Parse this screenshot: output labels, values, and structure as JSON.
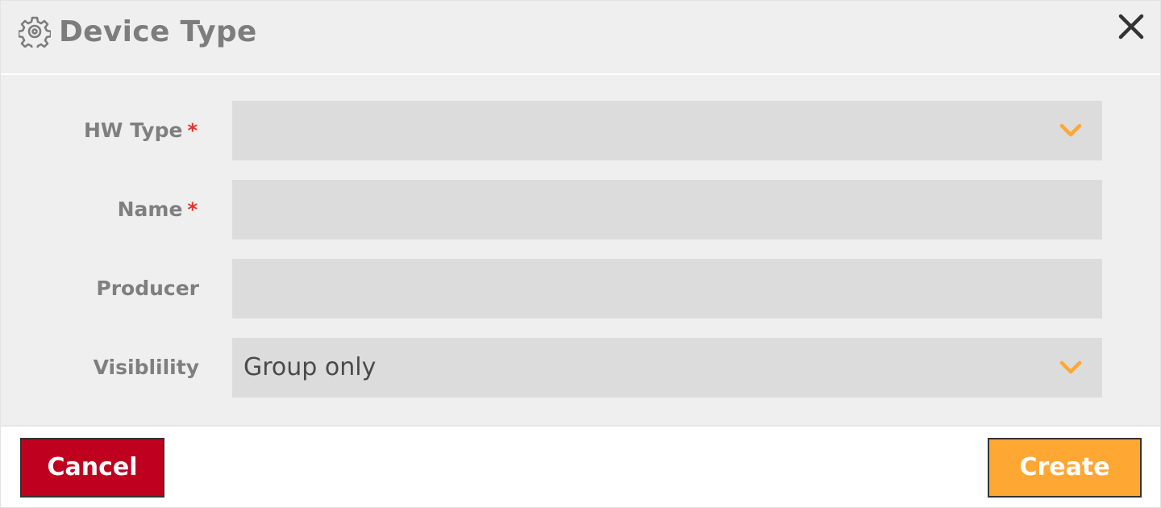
{
  "dialog": {
    "title": "Device Type",
    "icon": "gear-icon",
    "close_icon": "close-icon"
  },
  "form": {
    "hw_type": {
      "label": "HW Type",
      "required_mark": "*",
      "value": ""
    },
    "name": {
      "label": "Name",
      "required_mark": "*",
      "value": ""
    },
    "producer": {
      "label": "Producer",
      "value": ""
    },
    "visibility": {
      "label": "Visiblility",
      "value": "Group only"
    }
  },
  "footer": {
    "cancel_label": "Cancel",
    "create_label": "Create"
  },
  "colors": {
    "accent": "#ffa733",
    "danger": "#c0001f",
    "required": "#e8322b",
    "field_bg": "#dcdcdc",
    "panel_bg": "#efefef"
  }
}
